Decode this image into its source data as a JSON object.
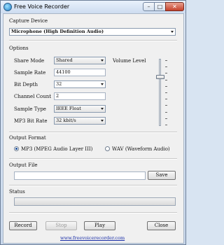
{
  "window": {
    "title": "Free Voice Recorder",
    "minimize": "–",
    "maximize": "□",
    "close": "✕"
  },
  "capture": {
    "label": "Capture Device",
    "device": "Microphone (High Definition Audio)"
  },
  "options": {
    "label": "Options",
    "share_mode": {
      "label": "Share Mode",
      "value": "Shared"
    },
    "sample_rate": {
      "label": "Sample Rate",
      "value": "44100"
    },
    "bit_depth": {
      "label": "Bit Depth",
      "value": "32"
    },
    "channel_count": {
      "label": "Channel Count",
      "value": "2"
    },
    "sample_type": {
      "label": "Sample Type",
      "value": "IEEE Float"
    },
    "mp3_bit_rate": {
      "label": "MP3 Bit Rate",
      "value": "32 kbit/s"
    },
    "volume_level": {
      "label": "Volume Level",
      "level": 0.75
    }
  },
  "output_format": {
    "label": "Output Format",
    "mp3": {
      "label": "MP3 (MPEG Audio Layer III)",
      "selected": true
    },
    "wav": {
      "label": "WAV (Waveform Audio)",
      "selected": false
    }
  },
  "output_file": {
    "label": "Output File",
    "value": "",
    "save": "Save"
  },
  "status": {
    "label": "Status",
    "progress": 0
  },
  "buttons": {
    "record": "Record",
    "stop": "Stop",
    "play": "Play",
    "close": "Close"
  },
  "footer": {
    "link": "www.freevoicerecorder.com"
  }
}
